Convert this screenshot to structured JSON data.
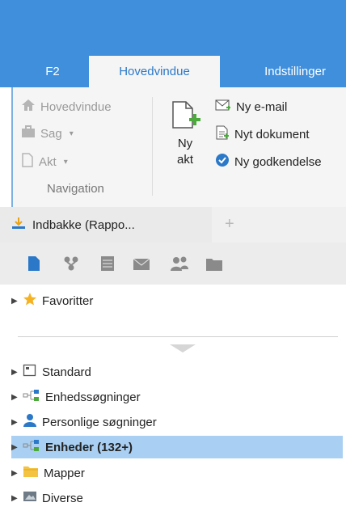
{
  "tabs": [
    {
      "label": "F2"
    },
    {
      "label": "Hovedvindue",
      "active": true
    },
    {
      "label": "Indstillinger"
    }
  ],
  "ribbon": {
    "navigation": {
      "items": [
        {
          "label": "Hovedvindue",
          "icon": "home-icon",
          "disabled": true
        },
        {
          "label": "Sag",
          "icon": "case-icon",
          "disabled": true,
          "dropdown": true
        },
        {
          "label": "Akt",
          "icon": "document-icon",
          "disabled": true,
          "dropdown": true
        }
      ],
      "group_label": "Navigation"
    },
    "new_act": {
      "line1": "Ny",
      "line2": "akt"
    },
    "actions": [
      {
        "label": "Ny e-mail",
        "icon": "email-icon"
      },
      {
        "label": "Nyt dokument",
        "icon": "new-document-icon"
      },
      {
        "label": "Ny godkendelse",
        "icon": "approval-icon"
      }
    ]
  },
  "doc_tab": {
    "label": "Indbakke (Rappo...",
    "icon": "inbox-icon"
  },
  "tree": {
    "favorites": "Favoritter",
    "items": [
      {
        "label": "Standard",
        "icon": "standard-icon"
      },
      {
        "label": "Enhedssøgninger",
        "icon": "unit-search-icon"
      },
      {
        "label": "Personlige søgninger",
        "icon": "person-icon"
      },
      {
        "label": "Enheder (132+)",
        "icon": "unit-icon",
        "selected": true
      },
      {
        "label": "Mapper",
        "icon": "folder-icon"
      },
      {
        "label": "Diverse",
        "icon": "misc-icon"
      }
    ]
  },
  "colors": {
    "accent": "#3f8fdc",
    "selected": "#a9d0f2",
    "icon_blue": "#2b78c8"
  }
}
